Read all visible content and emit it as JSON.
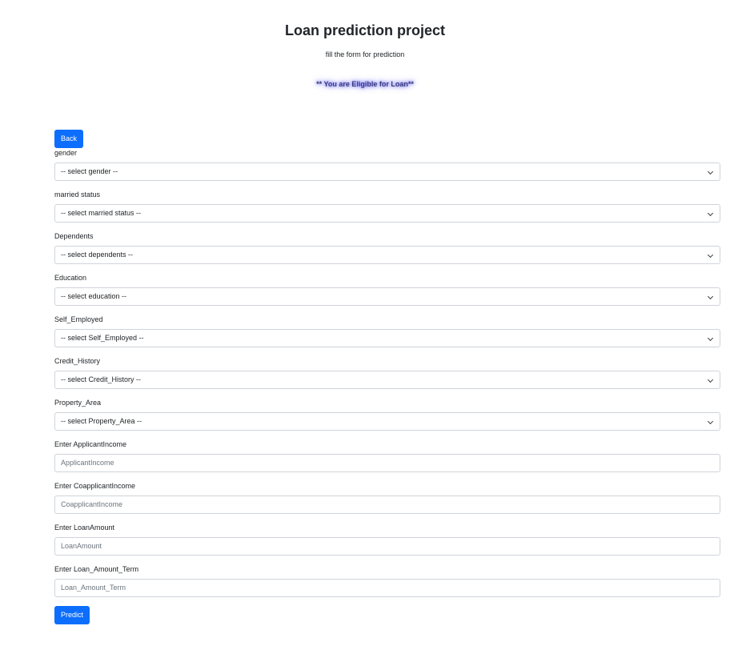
{
  "header": {
    "title": "Loan prediction project",
    "subtitle": "fill the form for prediction",
    "result": "** You are Eligible for Loan**"
  },
  "back_label": "Back",
  "selects": [
    {
      "key": "gender",
      "label": "gender",
      "value": "-- select gender --"
    },
    {
      "key": "married",
      "label": "married status",
      "value": "-- select married status --"
    },
    {
      "key": "dependents",
      "label": "Dependents",
      "value": "-- select dependents --"
    },
    {
      "key": "education",
      "label": "Education",
      "value": "-- select education --"
    },
    {
      "key": "self-employed",
      "label": "Self_Employed",
      "value": "-- select Self_Employed --"
    },
    {
      "key": "credit-history",
      "label": "Credit_History",
      "value": "-- select Credit_History --"
    },
    {
      "key": "property-area",
      "label": "Property_Area",
      "value": "-- select Property_Area --"
    }
  ],
  "inputs": [
    {
      "key": "applicant-income",
      "label": "Enter ApplicantIncome",
      "placeholder": "ApplicantIncome"
    },
    {
      "key": "coapplicant-income",
      "label": "Enter CoapplicantIncome",
      "placeholder": "CoapplicantIncome"
    },
    {
      "key": "loan-amount",
      "label": "Enter LoanAmount",
      "placeholder": "LoanAmount"
    },
    {
      "key": "loan-amount-term",
      "label": "Enter Loan_Amount_Term",
      "placeholder": "Loan_Amount_Term"
    }
  ],
  "predict_label": "Predict",
  "colors": {
    "primary": "#0d6efd",
    "result_glow": "#5b5bff"
  }
}
